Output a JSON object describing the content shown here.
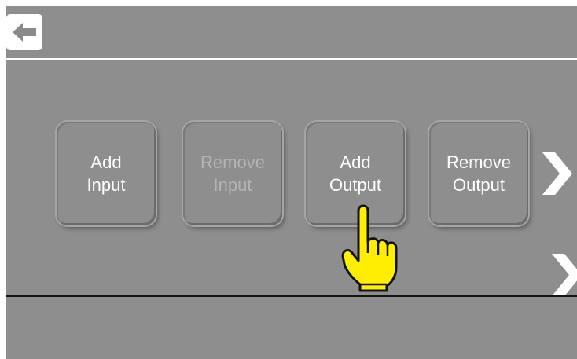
{
  "header": {
    "back_icon": "arrow-left-icon"
  },
  "buttons": [
    {
      "line1": "Add",
      "line2": "Input",
      "enabled": true
    },
    {
      "line1": "Remove",
      "line2": "Input",
      "enabled": false
    },
    {
      "line1": "Add",
      "line2": "Output",
      "enabled": true
    },
    {
      "line1": "Remove",
      "line2": "Output",
      "enabled": true
    }
  ],
  "navigation": {
    "next_page_icon": "chevron-right-icon",
    "next_section_icon": "chevron-right-icon"
  },
  "indicator": {
    "icon": "pointing-hand-icon",
    "color": "#ffee00"
  },
  "colors": {
    "background": "#8e8e8e",
    "text": "#ffffff",
    "disabled_text": "#b4b4b4"
  }
}
